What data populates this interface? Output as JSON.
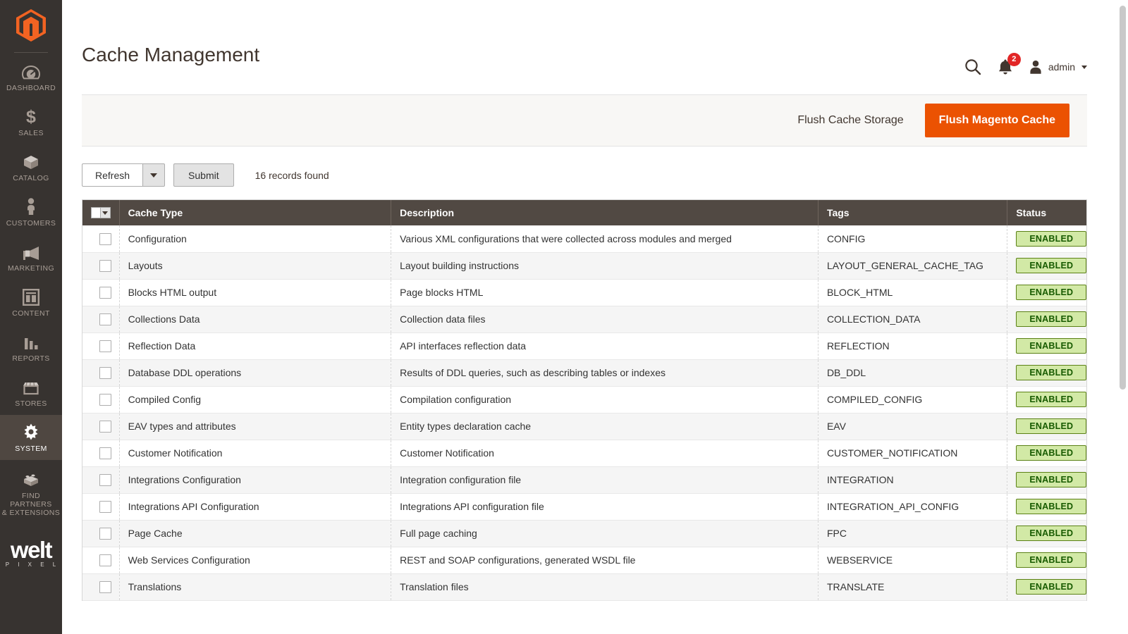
{
  "sidebar": {
    "logo": "magento-logo",
    "items": [
      {
        "label": "DASHBOARD",
        "icon": "dashboard-icon",
        "active": false
      },
      {
        "label": "SALES",
        "icon": "dollar-icon",
        "active": false
      },
      {
        "label": "CATALOG",
        "icon": "box-icon",
        "active": false
      },
      {
        "label": "CUSTOMERS",
        "icon": "person-icon",
        "active": false
      },
      {
        "label": "MARKETING",
        "icon": "megaphone-icon",
        "active": false
      },
      {
        "label": "CONTENT",
        "icon": "layout-icon",
        "active": false
      },
      {
        "label": "REPORTS",
        "icon": "bar-chart-icon",
        "active": false
      },
      {
        "label": "STORES",
        "icon": "storefront-icon",
        "active": false
      },
      {
        "label": "SYSTEM",
        "icon": "gear-icon",
        "active": true
      }
    ],
    "partners": {
      "line1": "FIND PARTNERS",
      "line2": "& EXTENSIONS",
      "icon": "brick-icon"
    },
    "brand": {
      "name": "welt",
      "subtitle": "P I X E L"
    }
  },
  "header": {
    "title": "Cache Management",
    "search_icon": "search-icon",
    "notifications": {
      "icon": "bell-icon",
      "count": "2"
    },
    "user": {
      "icon": "user-avatar-icon",
      "name": "admin"
    }
  },
  "page_actions": {
    "flush_cache_storage": "Flush Cache Storage",
    "flush_magento_cache": "Flush Magento Cache",
    "primary_color": "#eb5202"
  },
  "toolbar": {
    "mass_action_label": "Refresh",
    "submit_label": "Submit",
    "records_found": "16 records found"
  },
  "grid": {
    "columns": [
      "Cache Type",
      "Description",
      "Tags",
      "Status"
    ],
    "status_colors": {
      "enabled_bg": "#d2e9a6",
      "enabled_border": "#5b8116",
      "enabled_text": "#185b00"
    },
    "rows": [
      {
        "type": "Configuration",
        "description": "Various XML configurations that were collected across modules and merged",
        "tags": "CONFIG",
        "status": "ENABLED"
      },
      {
        "type": "Layouts",
        "description": "Layout building instructions",
        "tags": "LAYOUT_GENERAL_CACHE_TAG",
        "status": "ENABLED"
      },
      {
        "type": "Blocks HTML output",
        "description": "Page blocks HTML",
        "tags": "BLOCK_HTML",
        "status": "ENABLED"
      },
      {
        "type": "Collections Data",
        "description": "Collection data files",
        "tags": "COLLECTION_DATA",
        "status": "ENABLED"
      },
      {
        "type": "Reflection Data",
        "description": "API interfaces reflection data",
        "tags": "REFLECTION",
        "status": "ENABLED"
      },
      {
        "type": "Database DDL operations",
        "description": "Results of DDL queries, such as describing tables or indexes",
        "tags": "DB_DDL",
        "status": "ENABLED"
      },
      {
        "type": "Compiled Config",
        "description": "Compilation configuration",
        "tags": "COMPILED_CONFIG",
        "status": "ENABLED"
      },
      {
        "type": "EAV types and attributes",
        "description": "Entity types declaration cache",
        "tags": "EAV",
        "status": "ENABLED"
      },
      {
        "type": "Customer Notification",
        "description": "Customer Notification",
        "tags": "CUSTOMER_NOTIFICATION",
        "status": "ENABLED"
      },
      {
        "type": "Integrations Configuration",
        "description": "Integration configuration file",
        "tags": "INTEGRATION",
        "status": "ENABLED"
      },
      {
        "type": "Integrations API Configuration",
        "description": "Integrations API configuration file",
        "tags": "INTEGRATION_API_CONFIG",
        "status": "ENABLED"
      },
      {
        "type": "Page Cache",
        "description": "Full page caching",
        "tags": "FPC",
        "status": "ENABLED"
      },
      {
        "type": "Web Services Configuration",
        "description": "REST and SOAP configurations, generated WSDL file",
        "tags": "WEBSERVICE",
        "status": "ENABLED"
      },
      {
        "type": "Translations",
        "description": "Translation files",
        "tags": "TRANSLATE",
        "status": "ENABLED"
      }
    ]
  }
}
